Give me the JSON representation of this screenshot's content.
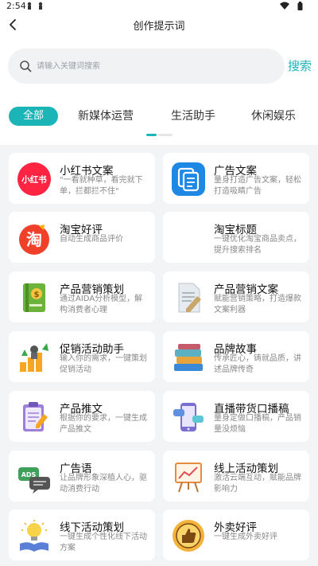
{
  "status_bar": {
    "time": "2:54",
    "icons": [
      "notification-icon",
      "notification-icon",
      "wifi-icon",
      "battery-icon"
    ]
  },
  "header": {
    "title": "创作提示词",
    "back_icon": "chevron-left-icon"
  },
  "search": {
    "placeholder": "请输入关键词搜索",
    "value": "",
    "button_label": "搜索",
    "icon": "search-icon"
  },
  "tabs": [
    {
      "label": "全部",
      "active": true
    },
    {
      "label": "新媒体运营",
      "active": false
    },
    {
      "label": "生活助手",
      "active": false
    },
    {
      "label": "休闲娱乐",
      "active": false
    }
  ],
  "colors": {
    "accent": "#1bb5b8",
    "page_bg": "#f3f4f6",
    "card_bg": "#ffffff",
    "desc": "#888888"
  },
  "cards": [
    {
      "title": "小红书文案",
      "desc": "\"一看就种草，看完就下单，拦都拦不住\"",
      "icon": "xiaohongshu-logo-icon",
      "icon_text": "小红书"
    },
    {
      "title": "广告文案",
      "desc": "量身打造广告文案，轻松打造吸睛广告",
      "icon": "copy-document-icon"
    },
    {
      "title": "淘宝好评",
      "desc": "自动生成商品评价",
      "icon": "taobao-logo-icon",
      "icon_text": "淘"
    },
    {
      "title": "淘宝标题",
      "desc": "一键优化淘宝商品卖点，提升搜索排名",
      "icon": ""
    },
    {
      "title": "产品营销策划",
      "desc": "通过AIDA分析模型，解构消费者心理",
      "icon": "money-notebook-icon"
    },
    {
      "title": "产品营销文案",
      "desc": "赋能营销策略，打造爆款文案利器",
      "icon": "document-pen-icon"
    },
    {
      "title": "促销活动助手",
      "desc": "输入你的需求，一键策划促销活动",
      "icon": "growth-chart-icon"
    },
    {
      "title": "品牌故事",
      "desc": "传承匠心，铸就品质，讲述品牌传奇",
      "icon": "books-stack-icon"
    },
    {
      "title": "产品推文",
      "desc": "根据你的要求，一键生成产品推文",
      "icon": "clipboard-pen-icon"
    },
    {
      "title": "直播带货口播稿",
      "desc": "量身定做口播稿，产品销量没烦恼",
      "icon": "phone-chat-icon"
    },
    {
      "title": "广告语",
      "desc": "让品牌形象深植人心，驱动消费行动",
      "icon": "ads-chat-bubble-icon",
      "icon_text": "ADS"
    },
    {
      "title": "线上活动策划",
      "desc": "激活云端互动，赋能品牌影响力",
      "icon": "presentation-board-icon"
    },
    {
      "title": "线下活动策划",
      "desc": "一键生成个性化线下活动方案",
      "icon": "lightbulb-book-icon"
    },
    {
      "title": "外卖好评",
      "desc": "一键生成外卖好评",
      "icon": "thumbs-up-badge-icon"
    }
  ]
}
